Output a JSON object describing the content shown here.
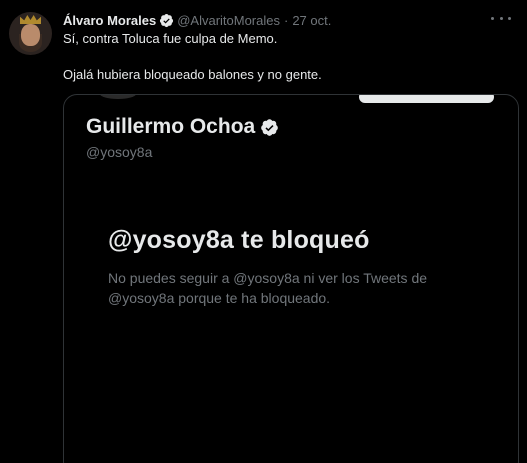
{
  "tweet": {
    "author_name": "Álvaro Morales",
    "author_handle": "@AlvaritoMorales",
    "separator": "·",
    "date": "27 oct.",
    "text_line_1": "Sí, contra Toluca fue culpa de Memo.",
    "text_line_2": "Ojalá hubiera bloqueado balones y no gente."
  },
  "embedded_screenshot": {
    "profile_name": "Guillermo Ochoa",
    "profile_handle": "@yosoy8a",
    "blocked_title": "@yosoy8a te bloqueó",
    "blocked_description": "No puedes seguir a @yosoy8a ni ver los Tweets de @yosoy8a porque te ha bloqueado."
  },
  "icons": {
    "verified": "verified-badge-icon",
    "more": "more-options-icon"
  },
  "colors": {
    "background": "#000000",
    "primary_text": "#e7e9ea",
    "secondary_text": "#71767b",
    "border": "#2f3336"
  }
}
